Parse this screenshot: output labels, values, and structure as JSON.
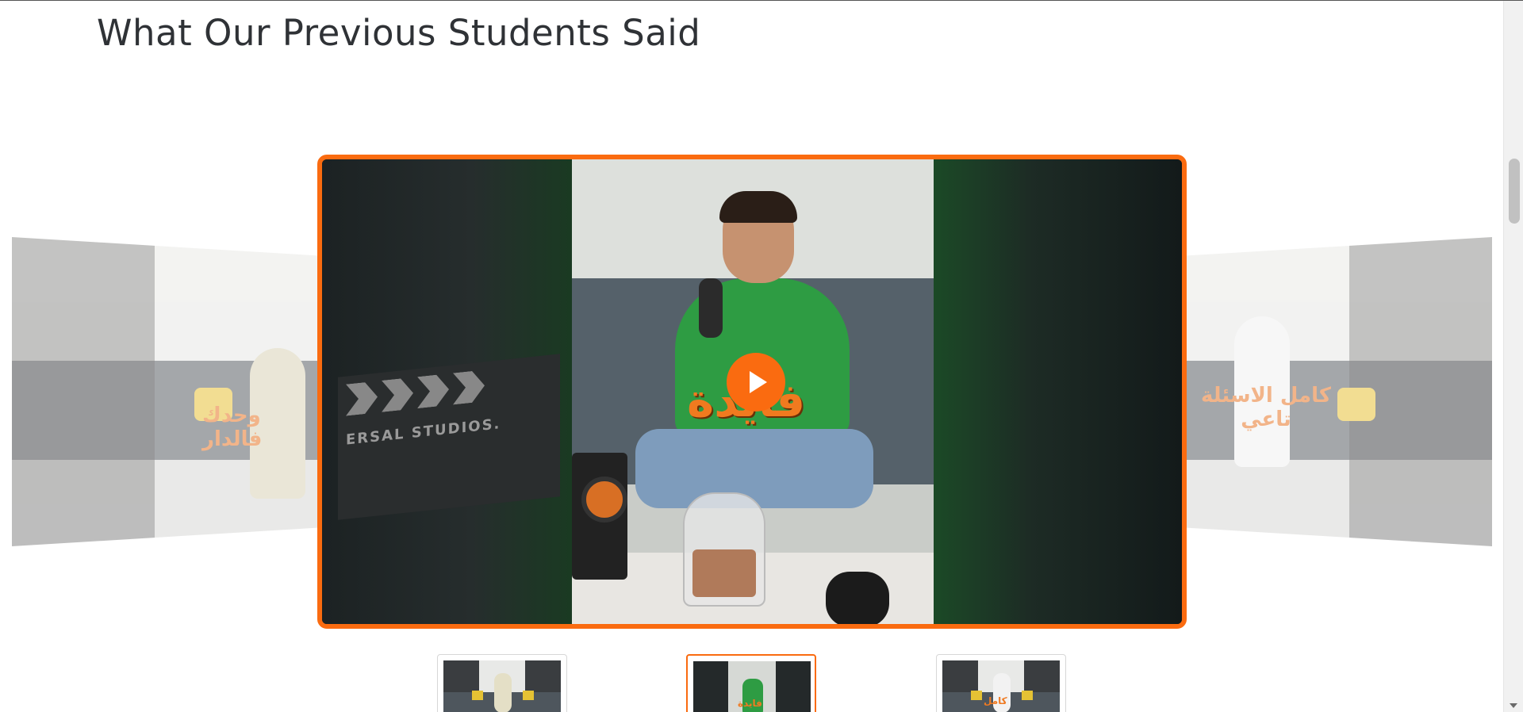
{
  "section": {
    "title": "What Our Previous Students Said"
  },
  "carousel": {
    "left_slide": {
      "overlay_text": "وحدك فالدار"
    },
    "main_slide": {
      "overlay_text": "فايدة",
      "clapper_text": "ERSAL STUDIOS."
    },
    "right_slide": {
      "overlay_text": "كامل الاسئلة تاعي"
    }
  },
  "thumbnails": [
    {
      "overlay_text": "",
      "active": false
    },
    {
      "overlay_text": "فايدة",
      "active": true
    },
    {
      "overlay_text": "كامل",
      "active": false
    }
  ],
  "colors": {
    "accent": "#fa6b10",
    "title": "#2f3236",
    "overlay_text": "#f07a1f"
  },
  "icons": {
    "play": "play-icon"
  }
}
